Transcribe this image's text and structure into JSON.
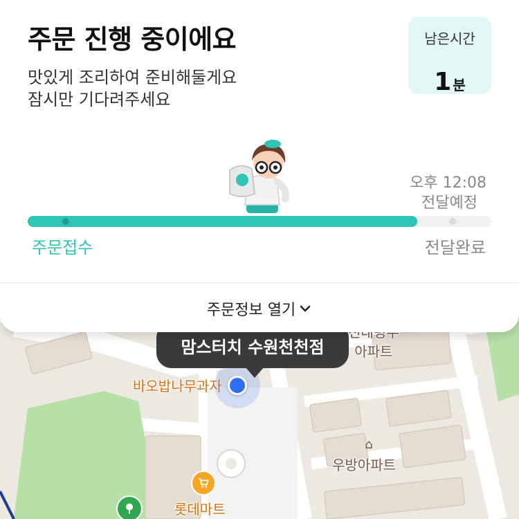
{
  "header": {
    "title": "주문 진행 중이에요",
    "subtitle_line1": "맛있게 조리하여 준비해둘게요",
    "subtitle_line2": "잠시만 기다려주세요"
  },
  "remaining": {
    "label": "남은시간",
    "value": "1",
    "unit": "분"
  },
  "eta": {
    "time": "오후 12:08",
    "label": "전달예정"
  },
  "progress": {
    "fraction": 0.84,
    "start_label": "주문접수",
    "end_label": "전달완료",
    "accent_color": "#2ec4b6"
  },
  "order_info_toggle": "주문정보 열기",
  "map": {
    "store_name": "맘스터치 수원천천점",
    "labels": {
      "apartment_top": "천태령우\n아파트",
      "bakery": "바오밥나무과자",
      "woobang": "우방아파트",
      "lotte": "롯데마트"
    },
    "icons": [
      "cart-icon",
      "house-icon",
      "tree-icon"
    ]
  }
}
